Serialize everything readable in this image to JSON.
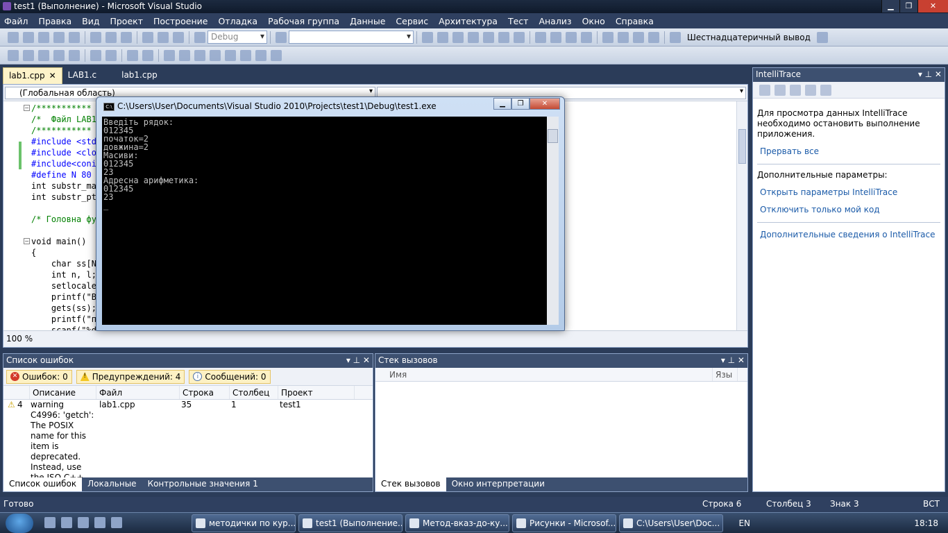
{
  "window": {
    "title": "test1 (Выполнение) - Microsoft Visual Studio",
    "minimize": "▁",
    "maximize": "❐",
    "close": "✕"
  },
  "menu": [
    "Файл",
    "Правка",
    "Вид",
    "Проект",
    "Построение",
    "Отладка",
    "Рабочая группа",
    "Данные",
    "Сервис",
    "Архитектура",
    "Тест",
    "Анализ",
    "Окно",
    "Справка"
  ],
  "toolbar": {
    "config": "Debug",
    "hex_label": "Шестнадцатеричный вывод"
  },
  "editor": {
    "tabs": [
      {
        "label": "lab1.cpp",
        "close": "✕"
      },
      {
        "label": "LAB1.c"
      },
      {
        "label": "lab1.cpp"
      }
    ],
    "scope": "(Глобальная область)",
    "zoom": "100 %",
    "code_lines": [
      "/***********",
      "/*  Файл LAB1",
      "/***********",
      "#include <stdi",
      "#include <cloc",
      "#include<conic",
      "#define N 80",
      "int substr_mas",
      "int substr_ptr",
      "",
      "/* Головна фун",
      "",
      "void main()",
      "{",
      "    char ss[N];",
      "    int n, l;",
      "    setlocale(",
      "    printf(\"Вв",
      "    gets(ss);",
      "    printf(\"по",
      "    scanf(\"%d\""
    ]
  },
  "console": {
    "title": "C:\\Users\\User\\Documents\\Visual Studio 2010\\Projects\\test1\\Debug\\test1.exe",
    "icon": "C:\\",
    "output": "Введіть рядок:\n012345\nпочаток=2\nдовжина=2\nМасиви:\n012345\n23\nАдресна арифметика:\n012345\n23\n_"
  },
  "intellitrace": {
    "title": "IntelliTrace",
    "message": "Для просмотра данных IntelliTrace необходимо остановить выполнение приложения.",
    "break_all": "Прервать все",
    "extra_params": "Дополнительные параметры:",
    "open_params": "Открыть параметры IntelliTrace",
    "just_my_code": "Отключить только мой код",
    "more_info": "Дополнительные сведения о IntelliTrace"
  },
  "error_list": {
    "title": "Список ошибок",
    "errors": "Ошибок: 0",
    "warnings": "Предупреждений: 4",
    "messages": "Сообщений: 0",
    "columns": [
      "Описание",
      "Файл",
      "Строка",
      "Столбец",
      "Проект"
    ],
    "row": {
      "num": "4",
      "description": "warning C4996: 'getch': The POSIX name for this item is deprecated. Instead, use the ISO C++ conformant",
      "file": "lab1.cpp",
      "line": "35",
      "column": "1",
      "project": "test1"
    }
  },
  "bottom_left_tabs": [
    "Список ошибок",
    "Локальные",
    "Контрольные значения 1"
  ],
  "call_stack": {
    "title": "Стек вызовов",
    "columns": [
      "Имя",
      "Язы"
    ]
  },
  "bottom_right_tabs": [
    "Стек вызовов",
    "Окно интерпретации"
  ],
  "status": {
    "ready": "Готово",
    "line": "Строка 6",
    "col": "Столбец 3",
    "char": "Знак 3",
    "ins": "ВСТ"
  },
  "taskbar": {
    "tasks": [
      "методички по кур...",
      "test1 (Выполнение...",
      "Метод-вказ-до-ку...",
      "Рисунки - Microsof...",
      "C:\\Users\\User\\Doc..."
    ],
    "lang": "EN",
    "time": "18:18"
  }
}
